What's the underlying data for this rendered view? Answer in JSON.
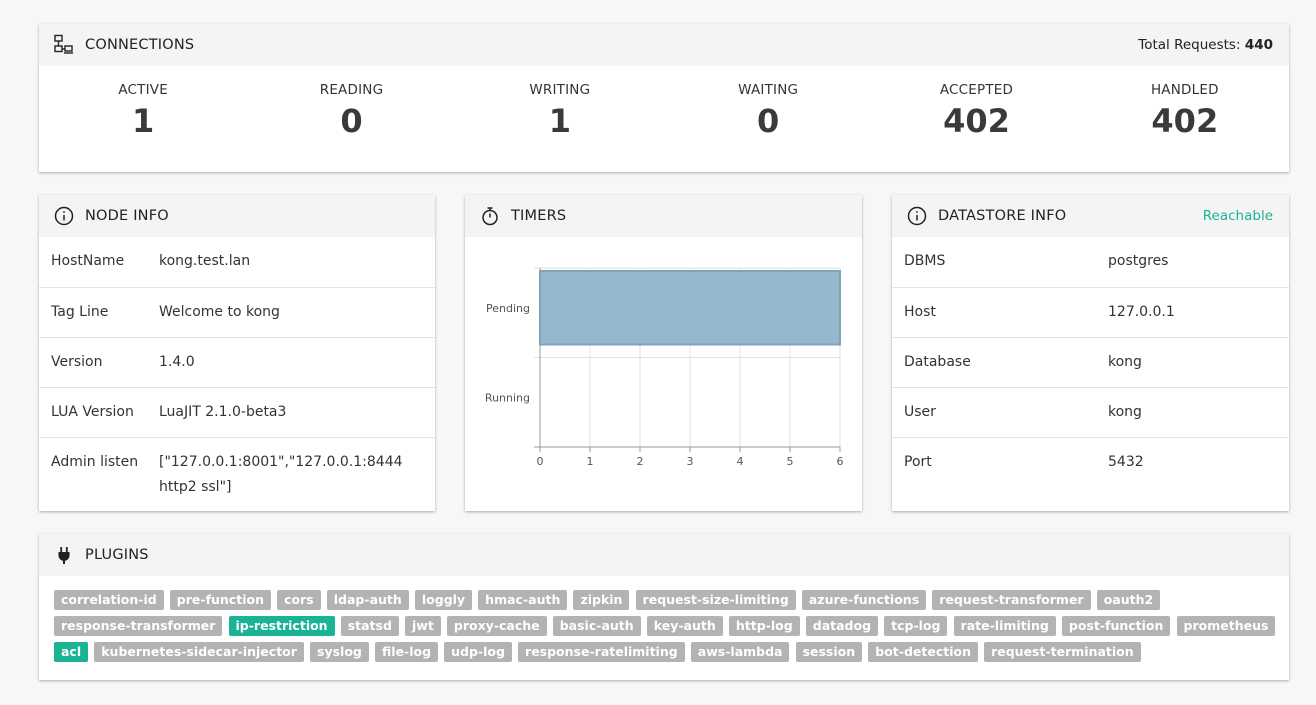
{
  "connections": {
    "title": "CONNECTIONS",
    "total_label": "Total Requests:",
    "total_value": "440",
    "stats": [
      {
        "label": "ACTIVE",
        "value": "1"
      },
      {
        "label": "READING",
        "value": "0"
      },
      {
        "label": "WRITING",
        "value": "1"
      },
      {
        "label": "WAITING",
        "value": "0"
      },
      {
        "label": "ACCEPTED",
        "value": "402"
      },
      {
        "label": "HANDLED",
        "value": "402"
      }
    ]
  },
  "node_info": {
    "title": "NODE INFO",
    "rows": [
      {
        "key": "HostName",
        "value": "kong.test.lan"
      },
      {
        "key": "Tag Line",
        "value": "Welcome to kong"
      },
      {
        "key": "Version",
        "value": "1.4.0"
      },
      {
        "key": "LUA Version",
        "value": "LuaJIT 2.1.0-beta3"
      },
      {
        "key": "Admin listen",
        "value": "[\"127.0.0.1:8001\",\"127.0.0.1:8444 http2 ssl\"]"
      }
    ]
  },
  "timers": {
    "title": "TIMERS"
  },
  "datastore": {
    "title": "DATASTORE INFO",
    "status": "Reachable",
    "status_color": "#1ab394",
    "rows": [
      {
        "key": "DBMS",
        "value": "postgres"
      },
      {
        "key": "Host",
        "value": "127.0.0.1"
      },
      {
        "key": "Database",
        "value": "kong"
      },
      {
        "key": "User",
        "value": "kong"
      },
      {
        "key": "Port",
        "value": "5432"
      }
    ]
  },
  "plugins": {
    "title": "PLUGINS",
    "items": [
      {
        "name": "correlation-id",
        "enabled": false
      },
      {
        "name": "pre-function",
        "enabled": false
      },
      {
        "name": "cors",
        "enabled": false
      },
      {
        "name": "ldap-auth",
        "enabled": false
      },
      {
        "name": "loggly",
        "enabled": false
      },
      {
        "name": "hmac-auth",
        "enabled": false
      },
      {
        "name": "zipkin",
        "enabled": false
      },
      {
        "name": "request-size-limiting",
        "enabled": false
      },
      {
        "name": "azure-functions",
        "enabled": false
      },
      {
        "name": "request-transformer",
        "enabled": false
      },
      {
        "name": "oauth2",
        "enabled": false
      },
      {
        "name": "response-transformer",
        "enabled": false
      },
      {
        "name": "ip-restriction",
        "enabled": true
      },
      {
        "name": "statsd",
        "enabled": false
      },
      {
        "name": "jwt",
        "enabled": false
      },
      {
        "name": "proxy-cache",
        "enabled": false
      },
      {
        "name": "basic-auth",
        "enabled": false
      },
      {
        "name": "key-auth",
        "enabled": false
      },
      {
        "name": "http-log",
        "enabled": false
      },
      {
        "name": "datadog",
        "enabled": false
      },
      {
        "name": "tcp-log",
        "enabled": false
      },
      {
        "name": "rate-limiting",
        "enabled": false
      },
      {
        "name": "post-function",
        "enabled": false
      },
      {
        "name": "prometheus",
        "enabled": false
      },
      {
        "name": "acl",
        "enabled": true
      },
      {
        "name": "kubernetes-sidecar-injector",
        "enabled": false
      },
      {
        "name": "syslog",
        "enabled": false
      },
      {
        "name": "file-log",
        "enabled": false
      },
      {
        "name": "udp-log",
        "enabled": false
      },
      {
        "name": "response-ratelimiting",
        "enabled": false
      },
      {
        "name": "aws-lambda",
        "enabled": false
      },
      {
        "name": "session",
        "enabled": false
      },
      {
        "name": "bot-detection",
        "enabled": false
      },
      {
        "name": "request-termination",
        "enabled": false
      }
    ]
  },
  "colors": {
    "accent": "#1ab394",
    "tag_disabled": "#b3b3b3",
    "bar_fill": "#96b8cc",
    "bar_stroke": "#7fa3b9"
  },
  "chart_data": {
    "type": "bar",
    "orientation": "horizontal",
    "categories": [
      "Pending",
      "Running"
    ],
    "values": [
      6,
      0
    ],
    "xlim": [
      0,
      6
    ],
    "xticks": [
      0,
      1,
      2,
      3,
      4,
      5,
      6
    ],
    "grid": true,
    "legend": "none"
  }
}
